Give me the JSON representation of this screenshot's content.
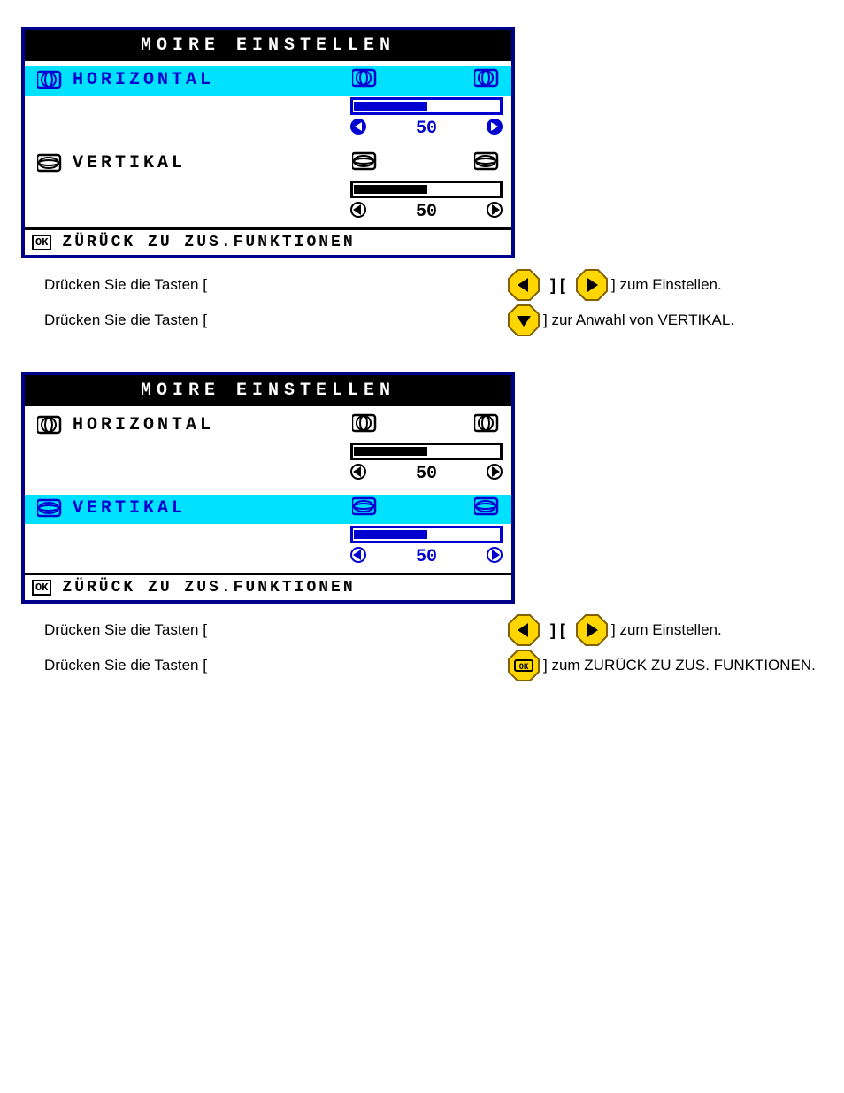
{
  "panel1": {
    "title": "MOIRE EINSTELLEN",
    "horizontal": {
      "label": "HORIZONTAL",
      "value": "50",
      "selected": true,
      "fill_pct": 50
    },
    "vertical": {
      "label": "VERTIKAL",
      "value": "50",
      "selected": false,
      "fill_pct": 50
    },
    "footer": {
      "ok": "OK",
      "text": "ZÜRÜCK ZU ZUS.FUNKTIONEN"
    }
  },
  "instr1_line1": "Drücken Sie die Tasten [",
  "instr1_line1b": "] zum Einstellen.",
  "instr1_line2": "Drücken Sie die Tasten [",
  "instr1_line2b": "] zur Anwahl von VERTIKAL.",
  "panel2": {
    "title": "MOIRE EINSTELLEN",
    "horizontal": {
      "label": "HORIZONTAL",
      "value": "50",
      "selected": false,
      "fill_pct": 50
    },
    "vertical": {
      "label": "VERTIKAL",
      "value": "50",
      "selected": true,
      "fill_pct": 50
    },
    "footer": {
      "ok": "OK",
      "text": "ZÜRÜCK ZU ZUS.FUNKTIONEN"
    }
  },
  "instr2_line1": "Drücken Sie die Tasten [",
  "instr2_line1b": "] zum Einstellen.",
  "instr2_line2": "Drücken Sie die Tasten [",
  "instr2_line2b": "] zum ZURÜCK ZU ZUS. FUNKTIONEN."
}
